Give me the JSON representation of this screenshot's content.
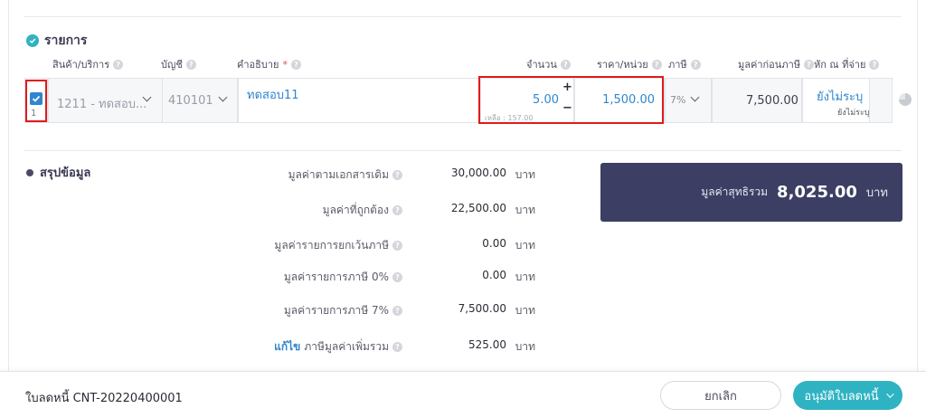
{
  "items_section": {
    "title": "รายการ",
    "columns": {
      "product": "สินค้า/บริการ",
      "account": "บัญชี",
      "description": "คำอธิบาย",
      "required_mark": "*",
      "quantity": "จำนวน",
      "unit_price": "ราคา/หน่วย",
      "tax": "ภาษี",
      "pre_tax_value": "มูลค่าก่อนภาษี",
      "withholding": "หัก ณ ที่จ่าย"
    },
    "row": {
      "number": "1",
      "product": "1211 - ทดสอบ...",
      "account": "410101",
      "description": "ทดสอบ11",
      "quantity": "5.00",
      "remaining": "เหลือ : 157.00",
      "plus": "+",
      "minus": "−",
      "unit_price": "1,500.00",
      "tax": "7%",
      "pre_tax_value": "7,500.00",
      "withholding": "ยังไม่ระบุ",
      "withholding_sub": "ยังไม่ระบุ"
    }
  },
  "summary": {
    "title": "สรุปข้อมูล",
    "rows": [
      {
        "label": "มูลค่าตามเอกสารเดิม",
        "value": "30,000.00",
        "unit": "บาท"
      },
      {
        "label": "มูลค่าที่ถูกต้อง",
        "value": "22,500.00",
        "unit": "บาท"
      },
      {
        "label": "มูลค่ารายการยกเว้นภาษี",
        "value": "0.00",
        "unit": "บาท"
      },
      {
        "label": "มูลค่ารายการภาษี 0%",
        "value": "0.00",
        "unit": "บาท"
      },
      {
        "label": "มูลค่ารายการภาษี 7%",
        "value": "7,500.00",
        "unit": "บาท"
      },
      {
        "edit": "แก้ไข",
        "label": "ภาษีมูลค่าเพิ่มรวม",
        "value": "525.00",
        "unit": "บาท"
      }
    ],
    "total": {
      "label": "มูลค่าสุทธิรวม",
      "value": "8,025.00",
      "unit": "บาท"
    }
  },
  "footer": {
    "document_number": "ใบลดหนี้ CNT-20220400001",
    "cancel_label": "ยกเลิก",
    "approve_label": "อนุมัติใบลดหนี้"
  },
  "colors": {
    "accent": "#2fb3c2",
    "link": "#2f86cf",
    "total_bg": "#3c3f63",
    "highlight": "#e01b1b"
  }
}
